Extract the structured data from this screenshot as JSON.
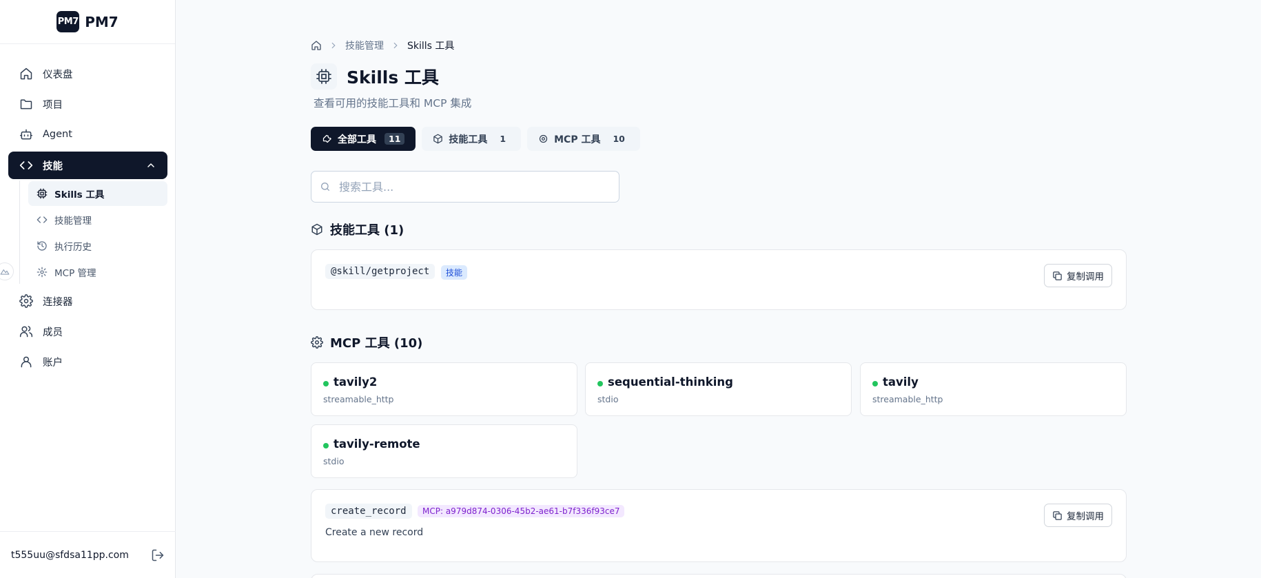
{
  "brand": {
    "logo_text": "PM7",
    "name": "PM7"
  },
  "sidebar": {
    "items": [
      {
        "label": "仪表盘",
        "icon": "home-icon"
      },
      {
        "label": "项目",
        "icon": "folder-icon"
      },
      {
        "label": "Agent",
        "icon": "bot-icon"
      },
      {
        "label": "技能",
        "icon": "code-icon",
        "active": true,
        "expanded": true
      },
      {
        "label": "连接器",
        "icon": "gear-icon"
      },
      {
        "label": "成员",
        "icon": "users-icon"
      },
      {
        "label": "账户",
        "icon": "user-icon"
      }
    ],
    "sub_items": [
      {
        "label": "Skills 工具",
        "icon": "cpu-icon",
        "active": true
      },
      {
        "label": "技能管理",
        "icon": "code-icon"
      },
      {
        "label": "执行历史",
        "icon": "history-icon"
      },
      {
        "label": "MCP 管理",
        "icon": "gear-icon"
      }
    ],
    "user_email": "t555uu@sfdsa11pp.com"
  },
  "breadcrumb": {
    "parent": "技能管理",
    "current": "Skills 工具"
  },
  "page": {
    "title": "Skills 工具",
    "subtitle": "查看可用的技能工具和 MCP 集成"
  },
  "tabs": [
    {
      "label": "全部工具",
      "count": "11",
      "active": true,
      "icon": "wrench-icon"
    },
    {
      "label": "技能工具",
      "count": "1",
      "icon": "package-icon"
    },
    {
      "label": "MCP 工具",
      "count": "10",
      "icon": "gear-icon"
    }
  ],
  "search": {
    "placeholder": "搜索工具...",
    "value": ""
  },
  "skill_section": {
    "title": "技能工具 (1)",
    "card": {
      "name": "@skill/getproject",
      "tag": "技能",
      "copy_label": "复制调用"
    }
  },
  "mcp_section": {
    "title": "MCP 工具 (10)",
    "servers": [
      {
        "name": "tavily2",
        "type": "streamable_http",
        "status": "online"
      },
      {
        "name": "sequential-thinking",
        "type": "stdio",
        "status": "online"
      },
      {
        "name": "tavily",
        "type": "streamable_http",
        "status": "online"
      },
      {
        "name": "tavily-remote",
        "type": "stdio",
        "status": "online"
      }
    ],
    "tool_card": {
      "name": "create_record",
      "tag": "MCP: a979d874-0306-45b2-ae61-b7f336f93ce7",
      "description": "Create a new record",
      "copy_label": "复制调用"
    }
  },
  "colors": {
    "primary": "#0f172a",
    "online": "#22c55e",
    "skill_tag": "#dbeafe",
    "mcp_tag": "#f3e8ff"
  }
}
